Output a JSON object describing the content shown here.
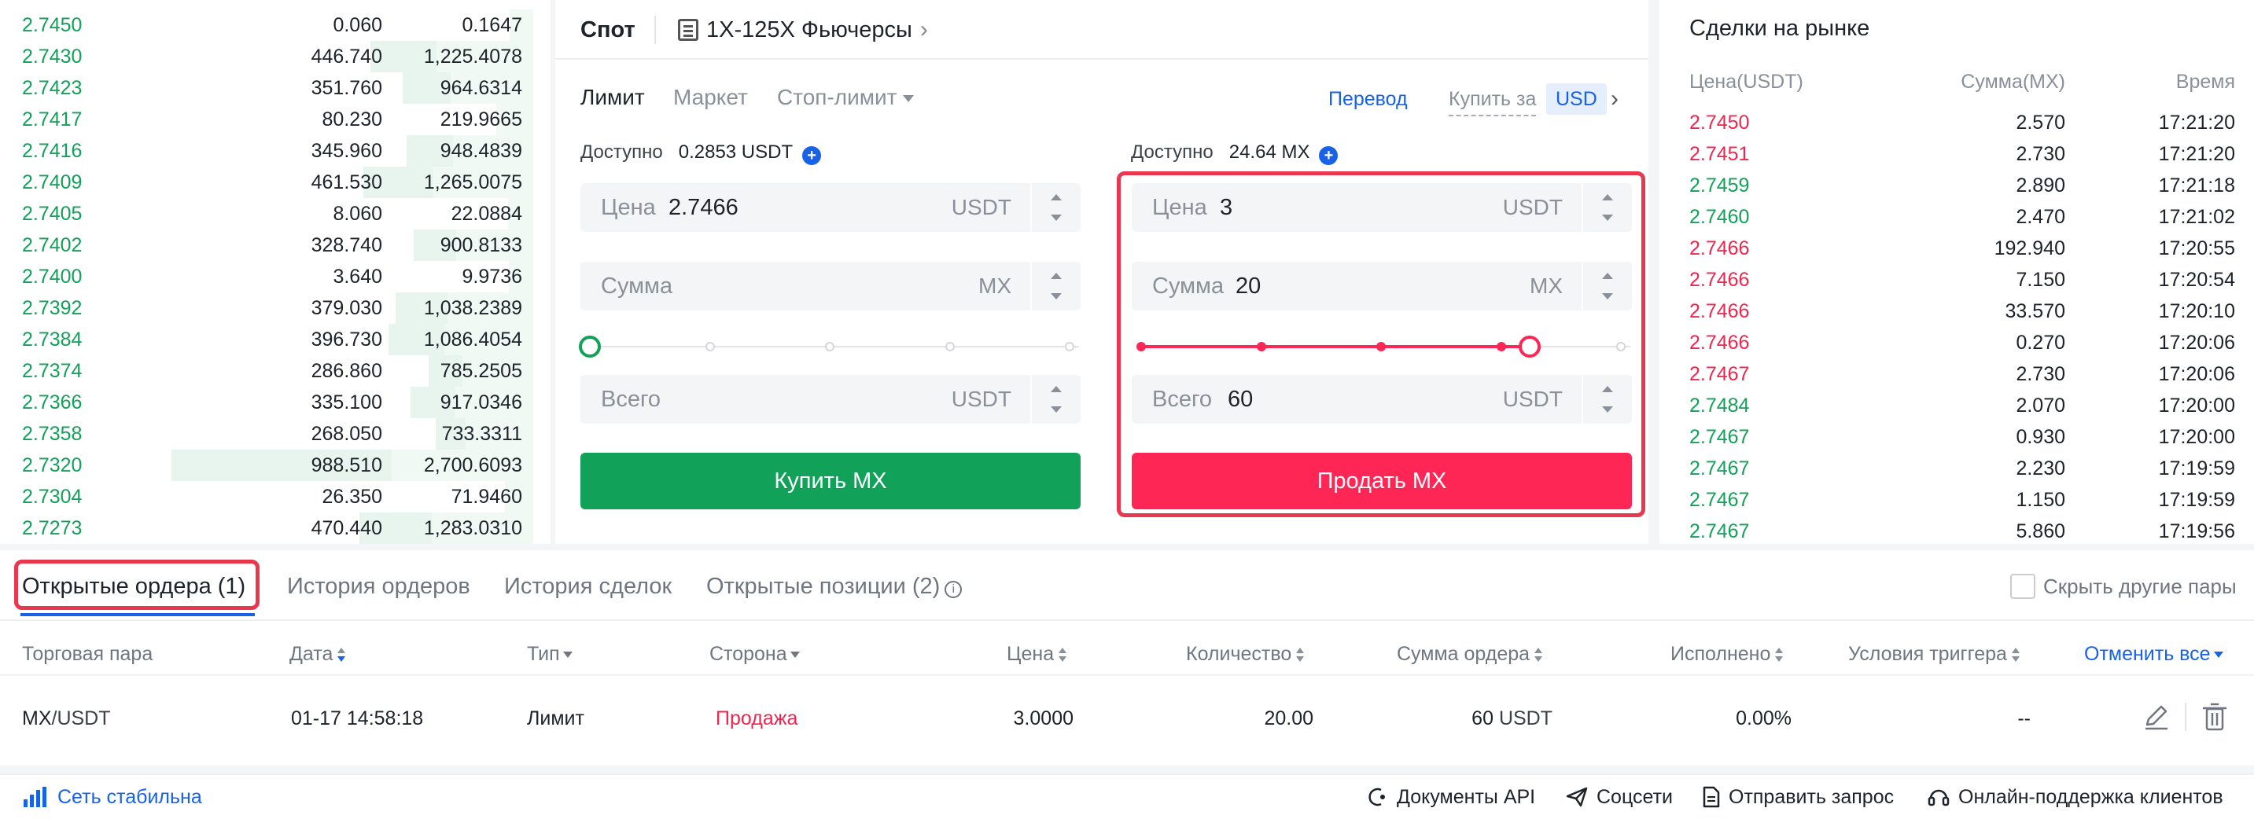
{
  "orderbook": {
    "rows": [
      {
        "price": "2.7450",
        "amount": "0.060",
        "total": "0.1647",
        "depth": 0.0
      },
      {
        "price": "2.7430",
        "amount": "446.740",
        "total": "1,225.4078",
        "depth": 0.45
      },
      {
        "price": "2.7423",
        "amount": "351.760",
        "total": "964.6314",
        "depth": 0.36
      },
      {
        "price": "2.7417",
        "amount": "80.230",
        "total": "219.9665",
        "depth": 0.08
      },
      {
        "price": "2.7416",
        "amount": "345.960",
        "total": "948.4839",
        "depth": 0.35
      },
      {
        "price": "2.7409",
        "amount": "461.530",
        "total": "1,265.0075",
        "depth": 0.47
      },
      {
        "price": "2.7405",
        "amount": "8.060",
        "total": "22.0884",
        "depth": 0.01
      },
      {
        "price": "2.7402",
        "amount": "328.740",
        "total": "900.8133",
        "depth": 0.33
      },
      {
        "price": "2.7400",
        "amount": "3.640",
        "total": "9.9736",
        "depth": 0.004
      },
      {
        "price": "2.7392",
        "amount": "379.030",
        "total": "1,038.2389",
        "depth": 0.38
      },
      {
        "price": "2.7384",
        "amount": "396.730",
        "total": "1,086.4054",
        "depth": 0.4
      },
      {
        "price": "2.7374",
        "amount": "286.860",
        "total": "785.2505",
        "depth": 0.29
      },
      {
        "price": "2.7366",
        "amount": "335.100",
        "total": "917.0346",
        "depth": 0.34
      },
      {
        "price": "2.7358",
        "amount": "268.050",
        "total": "733.3311",
        "depth": 0.27
      },
      {
        "price": "2.7320",
        "amount": "988.510",
        "total": "2,700.6093",
        "depth": 1.0
      },
      {
        "price": "2.7304",
        "amount": "26.350",
        "total": "71.9460",
        "depth": 0.03
      },
      {
        "price": "2.7273",
        "amount": "470.440",
        "total": "1,283.0310",
        "depth": 0.48
      }
    ]
  },
  "trade": {
    "spot_tab": "Спот",
    "futures_link": "1X-125X Фьючерсы",
    "order_types": [
      "Лимит",
      "Маркет",
      "Стоп-лимит"
    ],
    "transfer": "Перевод",
    "buy_for_label": "Купить за",
    "buy_for_currency": "USD",
    "buy": {
      "available_label": "Доступно",
      "available_value": "0.2853 USDT",
      "price_label": "Цена",
      "price_value": "2.7466",
      "price_unit": "USDT",
      "amount_label": "Сумма",
      "amount_value": "",
      "amount_unit": "MX",
      "total_label": "Всего",
      "total_value": "",
      "total_unit": "USDT",
      "slider_fraction": 0.0,
      "button": "Купить MX"
    },
    "sell": {
      "available_label": "Доступно",
      "available_value": "24.64 MX",
      "price_label": "Цена",
      "price_value": "3",
      "price_unit": "USDT",
      "amount_label": "Сумма",
      "amount_value": "20",
      "amount_unit": "MX",
      "total_label": "Всего",
      "total_value": "60",
      "total_unit": "USDT",
      "slider_fraction": 0.81,
      "button": "Продать MX"
    },
    "colors": {
      "buy": "#12a159",
      "sell": "#fd2654",
      "accent": "#1762e6",
      "highlight": "#e8384f"
    }
  },
  "market": {
    "title": "Сделки на рынке",
    "headers": {
      "price": "Цена(USDT)",
      "amount": "Сумма(MX)",
      "time": "Время"
    },
    "rows": [
      {
        "price": "2.7450",
        "amount": "2.570",
        "time": "17:21:20",
        "side": "sell"
      },
      {
        "price": "2.7451",
        "amount": "2.730",
        "time": "17:21:20",
        "side": "sell"
      },
      {
        "price": "2.7459",
        "amount": "2.890",
        "time": "17:21:18",
        "side": "buy"
      },
      {
        "price": "2.7460",
        "amount": "2.470",
        "time": "17:21:02",
        "side": "buy"
      },
      {
        "price": "2.7466",
        "amount": "192.940",
        "time": "17:20:55",
        "side": "sell"
      },
      {
        "price": "2.7466",
        "amount": "7.150",
        "time": "17:20:54",
        "side": "sell"
      },
      {
        "price": "2.7466",
        "amount": "33.570",
        "time": "17:20:10",
        "side": "sell"
      },
      {
        "price": "2.7466",
        "amount": "0.270",
        "time": "17:20:06",
        "side": "sell"
      },
      {
        "price": "2.7467",
        "amount": "2.730",
        "time": "17:20:06",
        "side": "sell"
      },
      {
        "price": "2.7484",
        "amount": "2.070",
        "time": "17:20:00",
        "side": "buy"
      },
      {
        "price": "2.7467",
        "amount": "0.930",
        "time": "17:20:00",
        "side": "buy"
      },
      {
        "price": "2.7467",
        "amount": "2.230",
        "time": "17:19:59",
        "side": "buy"
      },
      {
        "price": "2.7467",
        "amount": "1.150",
        "time": "17:19:59",
        "side": "buy"
      },
      {
        "price": "2.7467",
        "amount": "5.860",
        "time": "17:19:56",
        "side": "buy"
      }
    ]
  },
  "orders": {
    "tabs": [
      "Открытые ордера (1)",
      "История ордеров",
      "История сделок",
      "Открытые позиции (2)"
    ],
    "hide_other_pairs": "Скрыть другие пары",
    "headers": {
      "pair": "Торговая пара",
      "date": "Дата",
      "type": "Тип",
      "side": "Сторона",
      "price": "Цена",
      "qty": "Количество",
      "sum": "Сумма ордера",
      "filled": "Исполнено",
      "trigger": "Условия триггера",
      "cancel_all": "Отменить все"
    },
    "row": {
      "pair_base": "MX",
      "pair_quote": "/USDT",
      "date": "01-17 14:58:18",
      "type": "Лимит",
      "side": "Продажа",
      "price": "3.0000",
      "qty": "20.00",
      "sum_value": "60",
      "sum_unit": "USDT",
      "filled": "0.00%",
      "trigger": "--"
    }
  },
  "footer": {
    "status": "Сеть стабильна",
    "links": [
      "Документы API",
      "Соцсети",
      "Отправить запрос",
      "Онлайн-поддержка клиентов"
    ]
  }
}
